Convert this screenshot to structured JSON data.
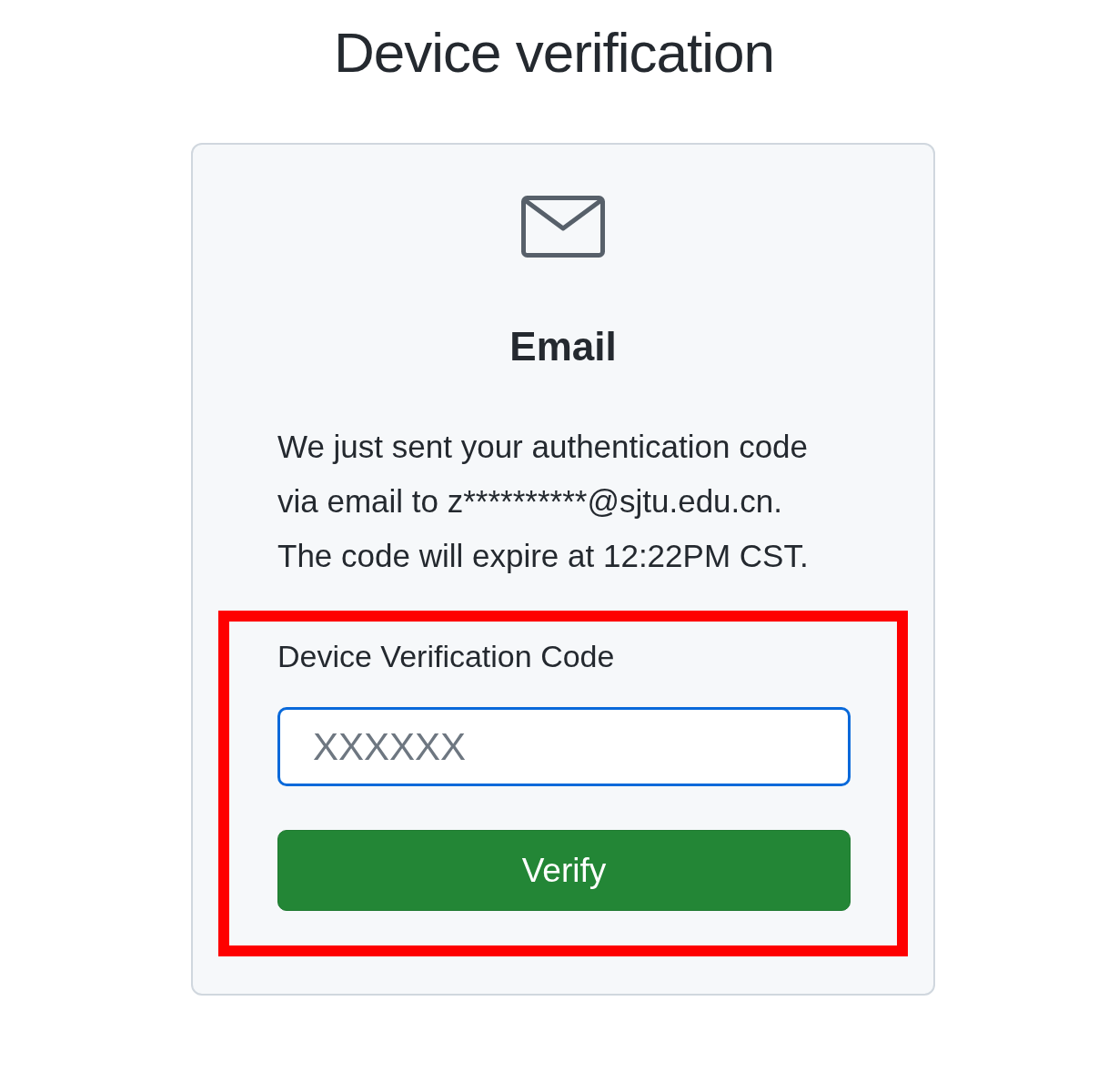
{
  "page": {
    "title": "Device verification"
  },
  "card": {
    "method": "Email",
    "message": "We just sent your authentication code via email to z**********@sjtu.edu.cn. The code will expire at 12:22PM CST.",
    "form": {
      "highlighted": true,
      "label": "Device Verification Code",
      "field": {
        "placeholder": "XXXXXX",
        "focused": true
      },
      "button": "Verify"
    }
  }
}
